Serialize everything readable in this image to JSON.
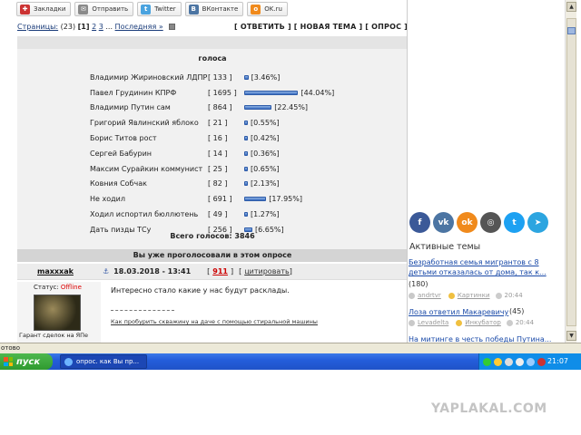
{
  "share_bar": [
    {
      "label": "Закладки",
      "icon": "bookmark-icon",
      "color": "#cc3333"
    },
    {
      "label": "Отправить",
      "icon": "mail-icon",
      "color": "#8a8a8a"
    },
    {
      "label": "Twitter",
      "icon": "twitter-icon",
      "color": "#4aa3df"
    },
    {
      "label": "ВКонтакте",
      "icon": "vk-icon",
      "color": "#4c75a3"
    },
    {
      "label": "OK.ru",
      "icon": "ok-icon",
      "color": "#f08a1c"
    }
  ],
  "pager": {
    "label": "Страницы:",
    "count": "(23)",
    "current": "[1]",
    "page2": "2",
    "page3": "3",
    "ellipsis": "...",
    "last": "Последняя »",
    "actions": "[ ОТВЕТИТЬ ] [ НОВАЯ ТЕМА ] [ ОПРОС ]"
  },
  "poll": {
    "title": "голоса",
    "options": [
      {
        "name": "Владимир Жириновский ЛДПР",
        "count": "[ 133 ]",
        "percent": 3.46,
        "percent_label": "[3.46%]"
      },
      {
        "name": "Павел Грудинин КПРФ",
        "count": "[ 1695 ]",
        "percent": 44.04,
        "percent_label": "[44.04%]"
      },
      {
        "name": "Владимир Путин сам",
        "count": "[ 864 ]",
        "percent": 22.45,
        "percent_label": "[22.45%]"
      },
      {
        "name": "Григорий Явлинский яблоко",
        "count": "[ 21 ]",
        "percent": 0.55,
        "percent_label": "[0.55%]"
      },
      {
        "name": "Борис Титов рост",
        "count": "[ 16 ]",
        "percent": 0.42,
        "percent_label": "[0.42%]"
      },
      {
        "name": "Сергей Бабурин",
        "count": "[ 14 ]",
        "percent": 0.36,
        "percent_label": "[0.36%]"
      },
      {
        "name": "Максим Сурайкин коммунист",
        "count": "[ 25 ]",
        "percent": 0.65,
        "percent_label": "[0.65%]"
      },
      {
        "name": "Ковния Собчак",
        "count": "[ 82 ]",
        "percent": 2.13,
        "percent_label": "[2.13%]"
      },
      {
        "name": "Не ходил",
        "count": "[ 691 ]",
        "percent": 17.95,
        "percent_label": "[17.95%]"
      },
      {
        "name": "Ходил испортил бюллютень",
        "count": "[ 49 ]",
        "percent": 1.27,
        "percent_label": "[1.27%]"
      },
      {
        "name": "Дать пизды ТСу",
        "count": "[ 256 ]",
        "percent": 6.65,
        "percent_label": "[6.65%]"
      }
    ],
    "total": "Всего голосов: 3846",
    "voted_notice": "Вы уже проголосовали в этом опросе"
  },
  "post": {
    "author": "maxxxak",
    "date": "18.03.2018 - 13:41",
    "rating": "911",
    "quote": "цитировать",
    "status_label": "Статус:",
    "status_value": "Offline",
    "guarantee": "Гарант сделок на ЯПе",
    "body": "Интересно стало какие у нас будут расклады.",
    "signature": "Как пробурить скважину на даче с помощью стиральной машины"
  },
  "sidebar": {
    "social": [
      {
        "icon": "facebook-icon",
        "glyph": "f",
        "color": "#3b5998"
      },
      {
        "icon": "vk-icon",
        "glyph": "vk",
        "color": "#4c75a3"
      },
      {
        "icon": "odnoklassniki-icon",
        "glyph": "ok",
        "color": "#f08a1c"
      },
      {
        "icon": "instagram-icon",
        "glyph": "◎",
        "color": "#555555"
      },
      {
        "icon": "twitter-icon",
        "glyph": "t",
        "color": "#1da1f2"
      },
      {
        "icon": "telegram-icon",
        "glyph": "➤",
        "color": "#2ca5e0"
      }
    ],
    "active_title": "Активные темы",
    "topics": [
      {
        "title": "Безработная семья мигрантов с 8 детьми отказалась от дома, так к...",
        "count": "(180)",
        "author": "andrtvr",
        "category": "Картинки",
        "time": "20:44"
      },
      {
        "title": "Лоза ответил Макаревичу",
        "count": "(45)",
        "author": "Levadelta",
        "category": "Инкубатор",
        "time": "20:44"
      },
      {
        "title": "На митинге в честь победы Путина..."
      }
    ]
  },
  "statusbar": {
    "text": "отово"
  },
  "taskbar": {
    "start_label": "пуск",
    "window_title": "опрос. как Вы пр...",
    "clock": "21:07"
  },
  "watermark": "YAPLAKAL.COM"
}
